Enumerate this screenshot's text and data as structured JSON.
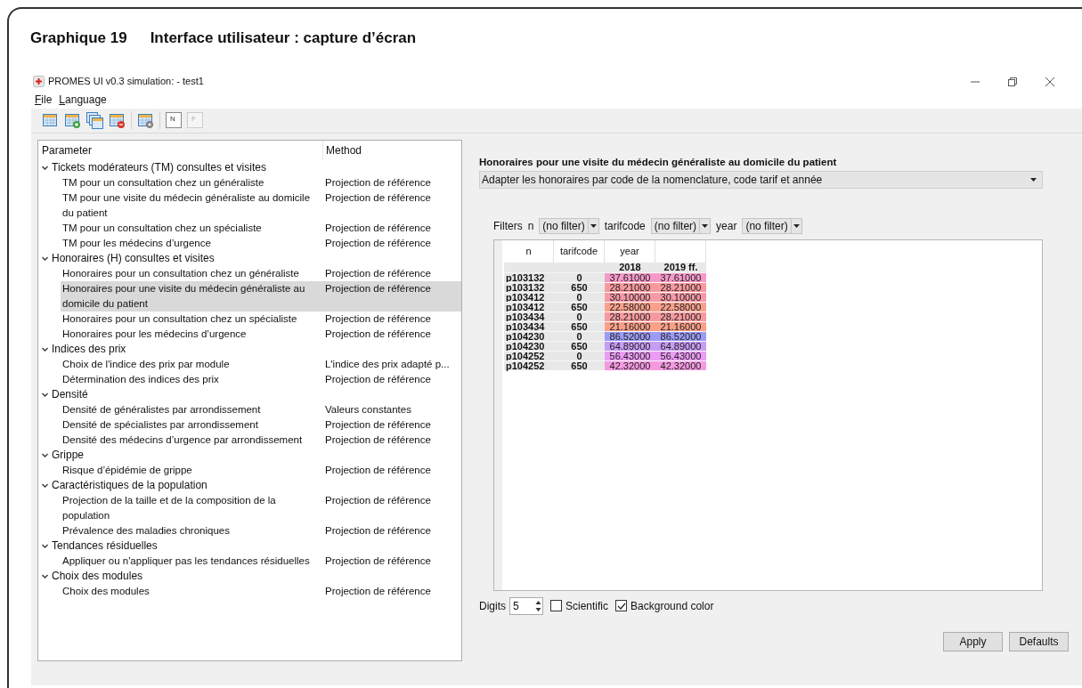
{
  "figure": {
    "number": "Graphique 19",
    "caption": "Interface utilisateur : capture d’écran"
  },
  "window": {
    "title": "PROMES UI v0.3 simulation: - test1"
  },
  "menu": [
    {
      "label": "File"
    },
    {
      "label": "Language"
    }
  ],
  "toolbar": [
    {
      "kind": "table"
    },
    {
      "kind": "table-add"
    },
    {
      "kind": "table-copy"
    },
    {
      "kind": "table-remove"
    },
    {
      "kind": "table-settings"
    },
    {
      "kind": "letter",
      "label": "N",
      "disabled": false
    },
    {
      "kind": "letter",
      "label": "F",
      "disabled": true
    }
  ],
  "tree": {
    "columns": [
      "Parameter",
      "Method"
    ],
    "groups": [
      {
        "label": "Tickets modérateurs (TM) consultes et visites",
        "expanded": true,
        "children": [
          {
            "label": "TM pour un consultation chez un généraliste",
            "method": "Projection de référence",
            "selected": false
          },
          {
            "label": "TM pour une visite du médecin généraliste au domicile du patient",
            "method": "Projection de référence",
            "selected": false
          },
          {
            "label": "TM pour un consultation chez un spécialiste",
            "method": "Projection de référence",
            "selected": false
          },
          {
            "label": "TM pour les médecins d’urgence",
            "method": "Projection de référence",
            "selected": false
          }
        ]
      },
      {
        "label": "Honoraires (H) consultes et visites",
        "expanded": true,
        "children": [
          {
            "label": "Honoraires pour un consultation chez un généraliste",
            "method": "Projection de référence",
            "selected": false
          },
          {
            "label": "Honoraires pour une visite du médecin généraliste au domicile du patient",
            "method": "Projection de référence",
            "selected": true
          },
          {
            "label": "Honoraires pour un consultation chez un spécialiste",
            "method": "Projection de référence",
            "selected": false
          },
          {
            "label": "Honoraires pour les médecins d’urgence",
            "method": "Projection de référence",
            "selected": false
          }
        ]
      },
      {
        "label": "Indices des prix",
        "expanded": true,
        "children": [
          {
            "label": "Choix de l'indice des prix par module",
            "method": "L'indice des prix adapté p...",
            "selected": false
          },
          {
            "label": "Détermination des indices des prix",
            "method": "Projection de référence",
            "selected": false
          }
        ]
      },
      {
        "label": "Densité",
        "expanded": true,
        "children": [
          {
            "label": "Densité de généralistes par arrondissement",
            "method": "Valeurs constantes",
            "selected": false
          },
          {
            "label": "Densité de spécialistes par arrondissement",
            "method": "Projection de référence",
            "selected": false
          },
          {
            "label": "Densité des médecins d’urgence par arrondissement",
            "method": "Projection de référence",
            "selected": false
          }
        ]
      },
      {
        "label": "Grippe",
        "expanded": true,
        "children": [
          {
            "label": "Risque d’épidémie de grippe",
            "method": "Projection de référence",
            "selected": false
          }
        ]
      },
      {
        "label": "Caractéristiques de la population",
        "expanded": true,
        "children": [
          {
            "label": "Projection de la taille et de la composition de la population",
            "method": "Projection de référence",
            "selected": false
          },
          {
            "label": "Prévalence des maladies chroniques",
            "method": "Projection de référence",
            "selected": false
          }
        ]
      },
      {
        "label": "Tendances résiduelles",
        "expanded": true,
        "children": [
          {
            "label": "Appliquer ou n'appliquer pas les tendances résiduelles",
            "method": "Projection de référence",
            "selected": false
          }
        ]
      },
      {
        "label": "Choix des modules",
        "expanded": true,
        "children": [
          {
            "label": "Choix des modules",
            "method": "Projection de référence",
            "selected": false
          }
        ]
      }
    ]
  },
  "detail": {
    "title": "Honoraires pour une visite du médecin généraliste au domicile du patient",
    "method_select": "Adapter les honoraires par code de la nomenclature, code tarif et année",
    "filters_label": "Filters",
    "filters": [
      {
        "name": "n",
        "value": "(no filter)"
      },
      {
        "name": "tarifcode",
        "value": "(no filter)"
      },
      {
        "name": "year",
        "value": "(no filter)"
      }
    ],
    "table": {
      "columns": [
        "n",
        "tarifcode",
        "year"
      ],
      "years": [
        "2018",
        "2019 ff."
      ],
      "rows": [
        {
          "n": "p103132",
          "tarifcode": "0",
          "values": [
            "37.61000",
            "37.61000"
          ],
          "color": "#f59ac8"
        },
        {
          "n": "p103132",
          "tarifcode": "650",
          "values": [
            "28.21000",
            "28.21000"
          ],
          "color": "#f79a9e"
        },
        {
          "n": "p103412",
          "tarifcode": "0",
          "values": [
            "30.10000",
            "30.10000"
          ],
          "color": "#f79aa8"
        },
        {
          "n": "p103412",
          "tarifcode": "650",
          "values": [
            "22.58000",
            "22.58000"
          ],
          "color": "#f9a08c"
        },
        {
          "n": "p103434",
          "tarifcode": "0",
          "values": [
            "28.21000",
            "28.21000"
          ],
          "color": "#f79a9e"
        },
        {
          "n": "p103434",
          "tarifcode": "650",
          "values": [
            "21.16000",
            "21.16000"
          ],
          "color": "#faa088"
        },
        {
          "n": "p104230",
          "tarifcode": "0",
          "values": [
            "86.52000",
            "86.52000"
          ],
          "color": "#9c9cf5"
        },
        {
          "n": "p104230",
          "tarifcode": "650",
          "values": [
            "64.89000",
            "64.89000"
          ],
          "color": "#c79cf5"
        },
        {
          "n": "p104252",
          "tarifcode": "0",
          "values": [
            "56.43000",
            "56.43000"
          ],
          "color": "#ec9cf5"
        },
        {
          "n": "p104252",
          "tarifcode": "650",
          "values": [
            "42.32000",
            "42.32000"
          ],
          "color": "#f59ae0"
        }
      ]
    },
    "digits_label": "Digits",
    "digits": "5",
    "options": [
      {
        "label": "Scientific",
        "checked": false
      },
      {
        "label": "Background color",
        "checked": true
      }
    ],
    "buttons": [
      "Apply",
      "Defaults"
    ]
  }
}
